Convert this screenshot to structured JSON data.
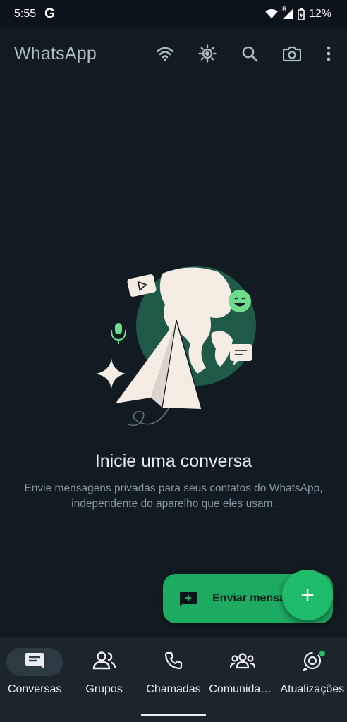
{
  "status_bar": {
    "time": "5:55",
    "g_logo": "G",
    "roaming_indicator": "R",
    "battery": "12%"
  },
  "app_bar": {
    "title": "WhatsApp",
    "icons": [
      "wifi-icon",
      "brightness-icon",
      "search-icon",
      "camera-icon",
      "more-vert-icon"
    ]
  },
  "empty_state": {
    "title": "Inicie uma conversa",
    "description": "Envie mensagens privadas para seus contatos do WhatsApp, independente do aparelho que eles usam."
  },
  "fab": {
    "label": "Enviar mensagem",
    "plus": "+",
    "accent": "#1daa61"
  },
  "bottom_nav": {
    "items": [
      {
        "label": "Conversas",
        "icon": "chats-icon",
        "active": true
      },
      {
        "label": "Grupos",
        "icon": "groups-icon",
        "active": false
      },
      {
        "label": "Chamadas",
        "icon": "phone-icon",
        "active": false
      },
      {
        "label": "Comunidades",
        "icon": "communities-icon",
        "active": false
      },
      {
        "label": "Atualizações",
        "icon": "updates-icon",
        "active": false,
        "badge_dot": true
      }
    ]
  },
  "colors": {
    "background": "#111b21",
    "nav_background": "#1b252b",
    "text_primary": "#e9edef",
    "text_secondary": "#8696a0",
    "green": "#21c063"
  }
}
